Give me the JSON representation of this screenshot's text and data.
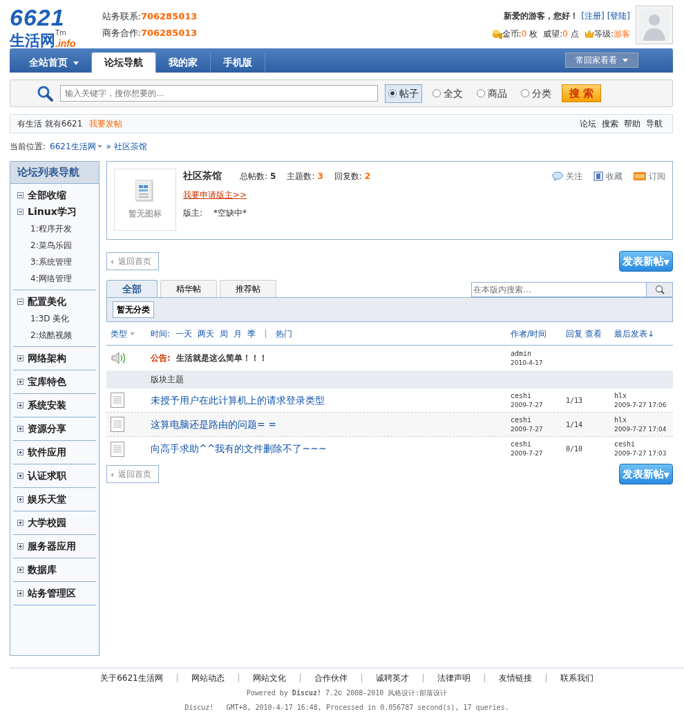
{
  "header": {
    "logo": {
      "number": "6621",
      "name": "生活网",
      "tm": "Tm",
      "suffix": ".info"
    },
    "contacts": [
      {
        "label": "站务联系:",
        "value": "706285013"
      },
      {
        "label": "商务合作:",
        "value": "706285013"
      }
    ],
    "greeting": "新爱的游客，您好！",
    "links": [
      "[注册]",
      "[登陆]"
    ],
    "stats": [
      {
        "kind": "coin",
        "label": "金币:",
        "value": "0",
        "unit": "枚"
      },
      {
        "kind": "plain",
        "label": "威望:",
        "value": "0",
        "unit": "点"
      },
      {
        "kind": "crown",
        "label": "等级:",
        "value": "游客"
      }
    ]
  },
  "nav": {
    "items": [
      {
        "label": "全站首页",
        "selected": false,
        "dropdown": true
      },
      {
        "label": "论坛导航",
        "selected": true,
        "dropdown": false
      },
      {
        "label": "我的家",
        "selected": false,
        "dropdown": false
      },
      {
        "label": "手机版",
        "selected": false,
        "dropdown": false
      }
    ],
    "right_button": "常回家看看"
  },
  "search": {
    "placeholder": "输入关键字，搜你想要的...",
    "options": [
      {
        "label": "帖子",
        "selected": true
      },
      {
        "label": "全文",
        "selected": false
      },
      {
        "label": "商品",
        "selected": false
      },
      {
        "label": "分类",
        "selected": false
      }
    ],
    "button": "搜 索"
  },
  "subbar": {
    "slogan": "有生活 就有6621",
    "post_link": "我要发帖",
    "links": [
      "论坛",
      "搜索",
      "帮助",
      "导航"
    ]
  },
  "breadcrumb": {
    "label": "当前位置:",
    "items": [
      "6621生活网",
      "» 社区茶馆"
    ]
  },
  "sidebar": {
    "title": "论坛列表导航",
    "sections": [
      {
        "items": [
          {
            "label": "全部收缩",
            "expanded": true
          },
          {
            "label": "Linux学习",
            "expanded": true,
            "children": [
              "1:程序开发",
              "2:菜鸟乐园",
              "3:系统管理",
              "4:网络管理"
            ]
          }
        ]
      },
      {
        "items": [
          {
            "label": "配置美化",
            "expanded": true,
            "children": [
              "1:3D 美化",
              "2:炫酷视频"
            ]
          }
        ]
      },
      {
        "items": [
          {
            "label": "网络架构",
            "expanded": false
          }
        ]
      },
      {
        "items": [
          {
            "label": "宝库特色",
            "expanded": false
          }
        ]
      },
      {
        "items": [
          {
            "label": "系统安装",
            "expanded": false
          }
        ]
      },
      {
        "items": [
          {
            "label": "资源分享",
            "expanded": false
          }
        ]
      },
      {
        "items": [
          {
            "label": "软件应用",
            "expanded": false
          }
        ]
      },
      {
        "items": [
          {
            "label": "认证求职",
            "expanded": false
          }
        ]
      },
      {
        "items": [
          {
            "label": "娱乐天堂",
            "expanded": false
          }
        ]
      },
      {
        "items": [
          {
            "label": "大学校园",
            "expanded": false
          }
        ]
      },
      {
        "items": [
          {
            "label": "服务器应用",
            "expanded": false
          }
        ]
      },
      {
        "items": [
          {
            "label": "数据库",
            "expanded": false
          }
        ]
      },
      {
        "items": [
          {
            "label": "站务管理区",
            "expanded": false
          }
        ]
      }
    ]
  },
  "forum": {
    "icon_text": "暂无图标",
    "name": "社区茶馆",
    "stats": [
      {
        "label": "总帖数:",
        "value": "5",
        "highlight": false
      },
      {
        "label": "主题数:",
        "value": "3",
        "highlight": true
      },
      {
        "label": "回复数:",
        "value": "2",
        "highlight": true
      }
    ],
    "apply_link": "我要申请版主>>",
    "moderator_label": "版主:",
    "moderator": "*空缺中*",
    "actions": [
      {
        "kind": "follow",
        "label": "关注"
      },
      {
        "kind": "favorite",
        "label": "收藏"
      },
      {
        "kind": "rss",
        "label": "订阅"
      }
    ]
  },
  "button_rows": [
    {
      "back_button": "返回首页",
      "new_post": "发表新帖",
      "caret": "▼"
    },
    {
      "back_button": "返回首页",
      "new_post": "发表新帖",
      "caret": "▼"
    }
  ],
  "tabs": [
    {
      "label": "全部",
      "selected": true
    },
    {
      "label": "精华帖",
      "selected": false
    },
    {
      "label": "推荐帖",
      "selected": false
    }
  ],
  "forum_search": {
    "placeholder": "在本版内搜索..."
  },
  "category": "暂无分类",
  "table_header": {
    "type": "类型",
    "time_label": "时间:",
    "filters": [
      "一天",
      "两天",
      "周",
      "月",
      "季"
    ],
    "hot": "热门",
    "author": "作者/时间",
    "replies": "回复",
    "views": "查看",
    "last": "最后发表↓"
  },
  "announcement": {
    "label": "公告:",
    "title": "生活就是这么简单！！！",
    "author": "admin",
    "date": "2010-4-17"
  },
  "section_label": "版块主题",
  "threads": [
    {
      "title": "未授予用户在此计算机上的请求登录类型",
      "author": "ceshi",
      "date": "2009-7-27",
      "counts": "1/13",
      "last_user": "hlx",
      "last_time": "2009-7-27 17:06"
    },
    {
      "title": "这算电脑还是路由的问题= =",
      "author": "ceshi",
      "date": "2009-7-27",
      "counts": "1/14",
      "last_user": "hlx",
      "last_time": "2009-7-27 17:04"
    },
    {
      "title": "向高手求助^^我有的文件删除不了~~~",
      "author": "ceshi",
      "date": "2009-7-27",
      "counts": "0/10",
      "last_user": "ceshi",
      "last_time": "2009-7-27 17:03"
    }
  ],
  "footer": {
    "links": [
      "关于6621生活网",
      "网站动态",
      "网站文化",
      "合作伙伴",
      "诚聘英才",
      "法律声明",
      "友情链接",
      "联系我们"
    ],
    "powered": "Powered by **Discuz!** 7.2© 2008-2010 风格设计:部落设计",
    "stats": "Discuz!   GMT+8, 2010-4-17 16:48, Processed in 0.056787 second(s), 17 queries."
  }
}
